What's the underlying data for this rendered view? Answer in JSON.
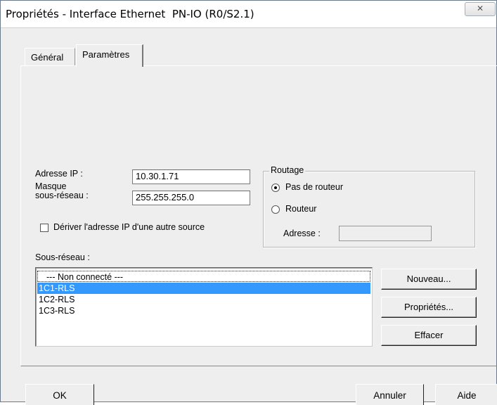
{
  "window": {
    "title": "Propriétés - Interface Ethernet  PN-IO (R0/S2.1)",
    "close_glyph": "✕"
  },
  "tabs": [
    {
      "label": "Général",
      "active": false
    },
    {
      "label": "Paramètres",
      "active": true
    }
  ],
  "ip_section": {
    "ip_label": "Adresse IP :",
    "ip_value": "10.30.1.71",
    "mask_label_line1": "Masque",
    "mask_label_line2": "sous-réseau :",
    "mask_value": "255.255.255.0",
    "derive_checkbox_label": "Dériver l'adresse IP d'une autre source",
    "derive_checked": false
  },
  "routing": {
    "legend": "Routage",
    "no_router_label": "Pas de routeur",
    "router_label": "Routeur",
    "selected": "no_router",
    "address_label": "Adresse :",
    "address_value": ""
  },
  "subnet": {
    "label": "Sous-réseau :",
    "items": [
      "--- Non connecté ---",
      "1C1-RLS",
      "1C2-RLS",
      "1C3-RLS"
    ],
    "selected_index": 1,
    "buttons": {
      "new": "Nouveau...",
      "properties": "Propriétés...",
      "delete": "Effacer"
    }
  },
  "footer": {
    "ok": "OK",
    "cancel": "Annuler",
    "help": "Aide"
  }
}
